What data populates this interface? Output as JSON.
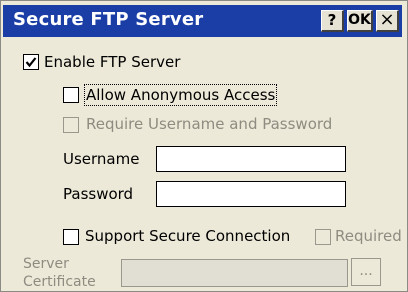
{
  "window": {
    "title": "Secure FTP Server",
    "help_label": "?",
    "ok_label": "OK",
    "close_label": "×"
  },
  "options": {
    "enable_ftp": {
      "label": "Enable FTP Server",
      "checked": true,
      "enabled": true
    },
    "allow_anonymous": {
      "label": "Allow Anonymous Access",
      "checked": false,
      "enabled": true,
      "focused": true
    },
    "require_auth": {
      "label": "Require Username and Password",
      "checked": false,
      "enabled": false
    }
  },
  "credentials": {
    "username_label": "Username",
    "username_value": "",
    "password_label": "Password",
    "password_value": ""
  },
  "secure": {
    "support_label": "Support Secure Connection",
    "support_checked": false,
    "required_label": "Required",
    "required_checked": false,
    "required_enabled": false
  },
  "certificate": {
    "label_line1": "Server",
    "label_line2": "Certificate",
    "value": "",
    "browse_label": "..."
  },
  "colors": {
    "titlebar": "#1a3ea6",
    "face": "#ece9d8",
    "disabled_text": "#8e8c80"
  }
}
